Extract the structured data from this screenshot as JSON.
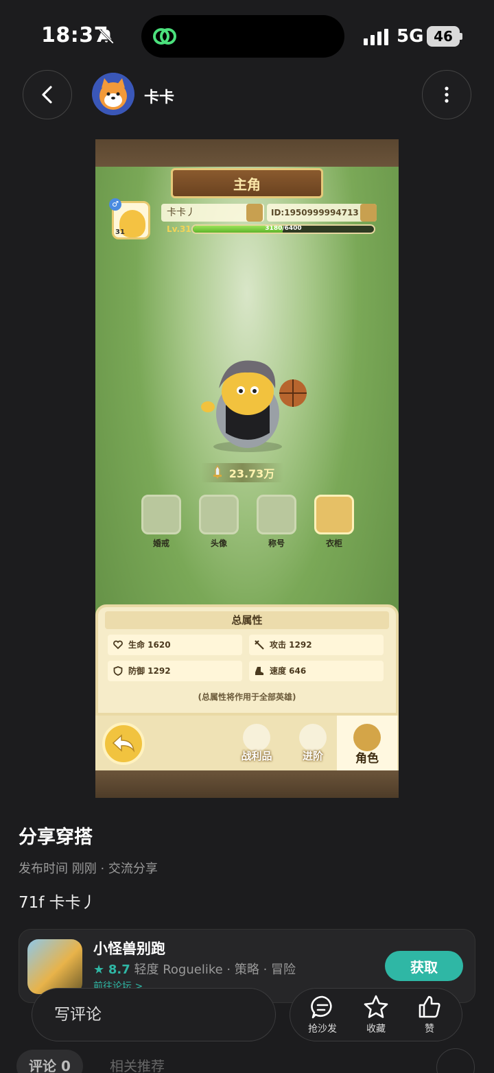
{
  "status_bar": {
    "time": "18:37",
    "network": "5G",
    "battery": "46"
  },
  "header": {
    "username": "卡卡"
  },
  "game": {
    "title": "主角",
    "player_name": "卡卡丿",
    "player_id": "ID:1950999994713",
    "avatar_level": "31",
    "level": "Lv.31",
    "xp_text": "3180/6400",
    "xp_fraction": 0.497,
    "power": "23.73万",
    "menu": [
      {
        "label": "婚戒"
      },
      {
        "label": "头像"
      },
      {
        "label": "称号"
      },
      {
        "label": "衣柜"
      }
    ],
    "attr_title": "总属性",
    "attrs": {
      "hp": "生命 1620",
      "atk": "攻击 1292",
      "def": "防御 1292",
      "spd": "速度 646"
    },
    "attr_note": "(总属性将作用于全部英雄)",
    "tabs": [
      {
        "label": "战利品"
      },
      {
        "label": "进阶"
      },
      {
        "label": "角色"
      }
    ]
  },
  "post": {
    "title": "分享穿搭",
    "meta": "发布时间 刚刚 · 交流分享",
    "body": "71f  卡卡丿"
  },
  "game_card": {
    "name": "小怪兽别跑",
    "rating": "8.7",
    "tags": "轻度 Roguelike · 策略 · 冒险",
    "link": "前往论坛 >",
    "get_label": "获取"
  },
  "bottom": {
    "comment_placeholder": "写评论",
    "sofa": "抢沙发",
    "fav": "收藏",
    "like": "赞"
  },
  "tabs": {
    "comments": "评论 0",
    "related": "相关推荐"
  },
  "colors": {
    "accent": "#2fb7a5",
    "background": "#1c1c1e"
  }
}
